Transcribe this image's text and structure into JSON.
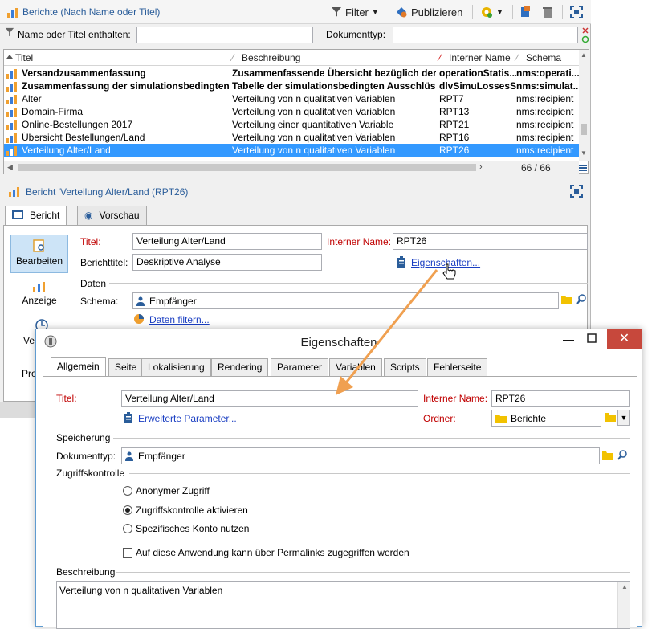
{
  "toolbar": {
    "title": "Berichte (Nach Name oder Titel)",
    "filter_label": "Filter",
    "publish_label": "Publizieren"
  },
  "filterbar": {
    "name_label": "Name oder Titel enthalten:",
    "name_value": "",
    "doctype_label": "Dokumenttyp:",
    "doctype_value": ""
  },
  "grid": {
    "columns": [
      "Titel",
      "Beschreibung",
      "Interner Name",
      "Schema"
    ],
    "rows": [
      {
        "title": "Versandzusammenfassung",
        "desc": "Zusammenfassende Übersicht bezüglich der...",
        "name": "operationStatis...",
        "schema": "nms:operati..."
      },
      {
        "title": "Zusammenfassung der simulationsbedingten ...",
        "desc": "Tabelle der simulationsbedingten Ausschlüsse",
        "name": "dlvSimuLossesS...",
        "schema": "nms:simulat..."
      },
      {
        "title": "Alter",
        "desc": "Verteilung von n qualitativen Variablen",
        "name": "RPT7",
        "schema": "nms:recipient"
      },
      {
        "title": "Domain-Firma",
        "desc": "Verteilung von n qualitativen Variablen",
        "name": "RPT13",
        "schema": "nms:recipient"
      },
      {
        "title": "Online-Bestellungen 2017",
        "desc": "Verteilung einer quantitativen Variable",
        "name": "RPT21",
        "schema": "nms:recipient"
      },
      {
        "title": "Übersicht Bestellungen/Land",
        "desc": "Verteilung von n qualitativen Variablen",
        "name": "RPT16",
        "schema": "nms:recipient"
      },
      {
        "title": "Verteilung Alter/Land",
        "desc": "Verteilung von n qualitativen Variablen",
        "name": "RPT26",
        "schema": "nms:recipient"
      }
    ],
    "count": "66 / 66"
  },
  "detail": {
    "header": "Bericht 'Verteilung Alter/Land (RPT26)'",
    "tab_report": "Bericht",
    "tab_preview": "Vorschau",
    "side_edit": "Bearbeiten",
    "side_display": "Anzeige",
    "side_ve": "Ve",
    "side_pro": "Pro",
    "title_label": "Titel:",
    "title_value": "Verteilung Alter/Land",
    "internal_label": "Interner Name:",
    "internal_value": "RPT26",
    "report_title_label": "Berichttitel:",
    "report_title_value": "Deskriptive Analyse",
    "properties_link": "Eigenschaften...",
    "data_section": "Daten",
    "schema_label": "Schema:",
    "schema_value": "Empfänger",
    "filter_link": "Daten filtern..."
  },
  "dialog": {
    "title": "Eigenschaften",
    "tabs": [
      "Allgemein",
      "Seite",
      "Lokalisierung",
      "Rendering",
      "Parameter",
      "Variablen",
      "Scripts",
      "Fehlerseite"
    ],
    "title_label": "Titel:",
    "title_value": "Verteilung Alter/Land",
    "internal_label": "Interner Name:",
    "internal_value": "RPT26",
    "advanced_link": "Erweiterte Parameter...",
    "folder_label": "Ordner:",
    "folder_value": "Berichte",
    "storage_section": "Speicherung",
    "doctype_label": "Dokumenttyp:",
    "doctype_value": "Empfänger",
    "access_section": "Zugriffskontrolle",
    "radio_anon": "Anonymer Zugriff",
    "radio_enable": "Zugriffskontrolle aktivieren",
    "radio_specific": "Spezifisches Konto nutzen",
    "permalink_check": "Auf diese Anwendung kann über Permalinks zugegriffen werden",
    "desc_section": "Beschreibung",
    "desc_value": "Verteilung von n qualitativen Variablen"
  },
  "colors": {
    "selection": "#3399ff",
    "link": "#1a3ec2",
    "required_label": "#c00000",
    "arrow": "#f0a050",
    "close_button": "#c7483c"
  }
}
